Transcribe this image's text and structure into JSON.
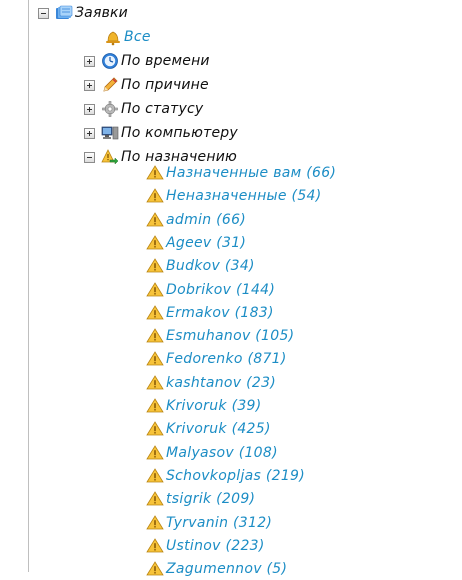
{
  "tree": {
    "root": {
      "label": "Заявки"
    },
    "all": {
      "label": "Все"
    },
    "groups": [
      {
        "label": "По времени",
        "expanded": false
      },
      {
        "label": "По причине",
        "expanded": false
      },
      {
        "label": "По статусу",
        "expanded": false
      },
      {
        "label": "По компьютеру",
        "expanded": false
      },
      {
        "label": "По назначению",
        "expanded": true
      }
    ],
    "assignments": [
      "Назначенные вам (66)",
      "Неназначенные (54)",
      "admin (66)",
      "Ageev (31)",
      "Budkov (34)",
      "Dobrikov (144)",
      "Ermakov (183)",
      "Esmuhanov (105)",
      "Fedorenko (871)",
      "kashtanov (23)",
      "Krivoruk (39)",
      "Krivoruk (425)",
      "Malyasov (108)",
      "Schovkopljas (219)",
      "tsigrik (209)",
      "Tyrvanin (312)",
      "Ustinov (223)",
      "Zagumennov (5)"
    ]
  },
  "colors": {
    "link": "#1c8dc5",
    "text": "#101010"
  },
  "icons": {
    "root": "folder-cards-icon",
    "all": "bell-icon",
    "time": "clock-icon",
    "reason": "pencil-icon",
    "status": "gear-icon",
    "computer": "computer-icon",
    "assignment": "warning-arrow-icon",
    "assignee": "warning-icon"
  }
}
